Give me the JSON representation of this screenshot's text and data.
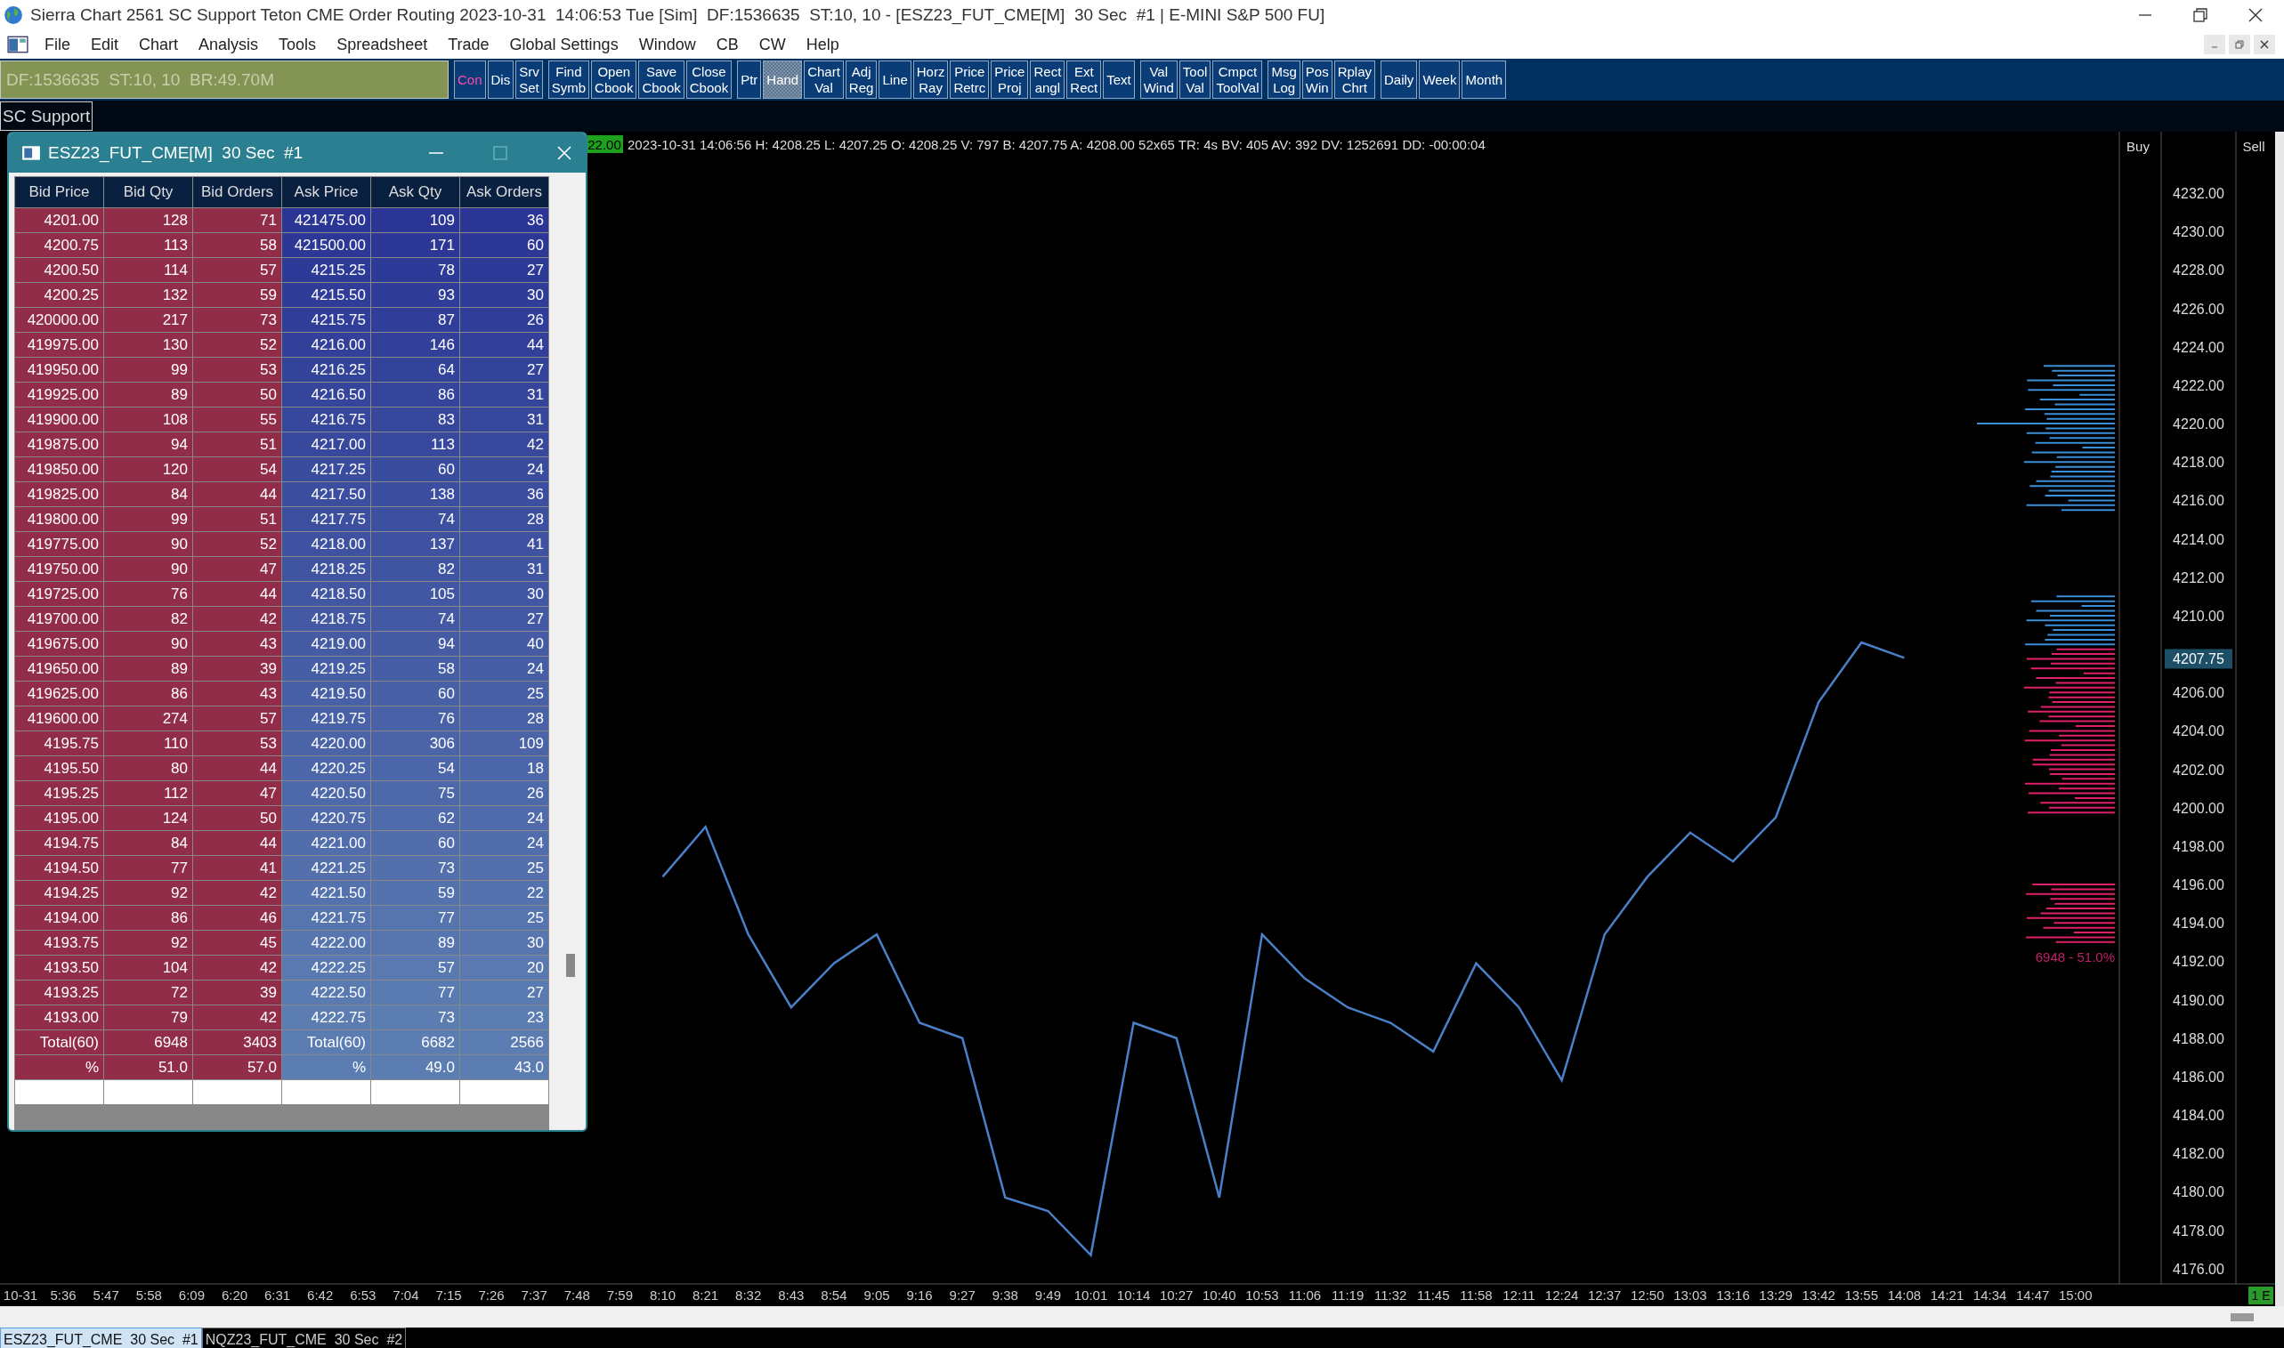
{
  "window": {
    "title": "Sierra Chart 2561 SC Support Teton CME Order Routing 2023-10-31  14:06:53 Tue [Sim]  DF:1536635  ST:10, 10 - [ESZ23_FUT_CME[M]  30 Sec  #1 | E-MINI S&P 500 FU]"
  },
  "menu": {
    "items": [
      "File",
      "Edit",
      "Chart",
      "Analysis",
      "Tools",
      "Spreadsheet",
      "Trade",
      "Global Settings",
      "Window",
      "CB",
      "CW",
      "Help"
    ]
  },
  "status": {
    "text": "DF:1536635  ST:10, 10  BR:49.70M"
  },
  "toolbar": {
    "groups": [
      {
        "buttons": [
          {
            "label": "Con",
            "lit": true,
            "selected": false
          },
          {
            "label": "Dis",
            "lit": false,
            "selected": false
          },
          {
            "label": "Srv\nSet",
            "lit": false,
            "selected": false
          }
        ]
      },
      {
        "buttons": [
          {
            "label": "Find\nSymb",
            "lit": false,
            "selected": false
          },
          {
            "label": "Open\nCbook",
            "lit": false,
            "selected": false
          },
          {
            "label": "Save\nCbook",
            "lit": false,
            "selected": false
          },
          {
            "label": "Close\nCbook",
            "lit": false,
            "selected": false
          }
        ]
      },
      {
        "buttons": [
          {
            "label": "Ptr",
            "lit": false,
            "selected": false
          },
          {
            "label": "Hand",
            "lit": false,
            "selected": true
          },
          {
            "label": "Chart\nVal",
            "lit": false,
            "selected": false
          },
          {
            "label": "Adj\nReg",
            "lit": false,
            "selected": false
          },
          {
            "label": "Line",
            "lit": false,
            "selected": false
          },
          {
            "label": "Horz\nRay",
            "lit": false,
            "selected": false
          },
          {
            "label": "Price\nRetrc",
            "lit": false,
            "selected": false
          },
          {
            "label": "Price\nProj",
            "lit": false,
            "selected": false
          },
          {
            "label": "Rect\nangl",
            "lit": false,
            "selected": false
          },
          {
            "label": "Ext\nRect",
            "lit": false,
            "selected": false
          },
          {
            "label": "Text",
            "lit": false,
            "selected": false
          }
        ]
      },
      {
        "buttons": [
          {
            "label": "Val\nWind",
            "lit": false,
            "selected": false
          },
          {
            "label": "Tool\nVal",
            "lit": false,
            "selected": false
          },
          {
            "label": "Cmpct\nToolVal",
            "lit": false,
            "selected": false
          }
        ]
      },
      {
        "buttons": [
          {
            "label": "Msg\nLog",
            "lit": false,
            "selected": false
          },
          {
            "label": "Pos\nWin",
            "lit": false,
            "selected": false
          },
          {
            "label": "Rplay\nChrt",
            "lit": false,
            "selected": false
          }
        ]
      },
      {
        "buttons": [
          {
            "label": "Daily",
            "lit": false,
            "selected": false
          },
          {
            "label": "Week",
            "lit": false,
            "selected": false
          },
          {
            "label": "Month",
            "lit": false,
            "selected": false
          }
        ]
      }
    ]
  },
  "chartbook_tabs": [
    {
      "label": "SC Support"
    }
  ],
  "dom_window": {
    "title": "ESZ23_FUT_CME[M]  30 Sec  #1",
    "columns": [
      "Bid Price",
      "Bid Qty",
      "Bid Orders",
      "Ask Price",
      "Ask Qty",
      "Ask Orders"
    ],
    "rows": [
      [
        "4201.00",
        "128",
        "71",
        "421475.00",
        "109",
        "36"
      ],
      [
        "4200.75",
        "113",
        "58",
        "421500.00",
        "171",
        "60"
      ],
      [
        "4200.50",
        "114",
        "57",
        "4215.25",
        "78",
        "27"
      ],
      [
        "4200.25",
        "132",
        "59",
        "4215.50",
        "93",
        "30"
      ],
      [
        "420000.00",
        "217",
        "73",
        "4215.75",
        "87",
        "26"
      ],
      [
        "419975.00",
        "130",
        "52",
        "4216.00",
        "146",
        "44"
      ],
      [
        "419950.00",
        "99",
        "53",
        "4216.25",
        "64",
        "27"
      ],
      [
        "419925.00",
        "89",
        "50",
        "4216.50",
        "86",
        "31"
      ],
      [
        "419900.00",
        "108",
        "55",
        "4216.75",
        "83",
        "31"
      ],
      [
        "419875.00",
        "94",
        "51",
        "4217.00",
        "113",
        "42"
      ],
      [
        "419850.00",
        "120",
        "54",
        "4217.25",
        "60",
        "24"
      ],
      [
        "419825.00",
        "84",
        "44",
        "4217.50",
        "138",
        "36"
      ],
      [
        "419800.00",
        "99",
        "51",
        "4217.75",
        "74",
        "28"
      ],
      [
        "419775.00",
        "90",
        "52",
        "4218.00",
        "137",
        "41"
      ],
      [
        "419750.00",
        "90",
        "47",
        "4218.25",
        "82",
        "31"
      ],
      [
        "419725.00",
        "76",
        "44",
        "4218.50",
        "105",
        "30"
      ],
      [
        "419700.00",
        "82",
        "42",
        "4218.75",
        "74",
        "27"
      ],
      [
        "419675.00",
        "90",
        "43",
        "4219.00",
        "94",
        "40"
      ],
      [
        "419650.00",
        "89",
        "39",
        "4219.25",
        "58",
        "24"
      ],
      [
        "419625.00",
        "86",
        "43",
        "4219.50",
        "60",
        "25"
      ],
      [
        "419600.00",
        "274",
        "57",
        "4219.75",
        "76",
        "28"
      ],
      [
        "4195.75",
        "110",
        "53",
        "4220.00",
        "306",
        "109"
      ],
      [
        "4195.50",
        "80",
        "44",
        "4220.25",
        "54",
        "18"
      ],
      [
        "4195.25",
        "112",
        "47",
        "4220.50",
        "75",
        "26"
      ],
      [
        "4195.00",
        "124",
        "50",
        "4220.75",
        "62",
        "24"
      ],
      [
        "4194.75",
        "84",
        "44",
        "4221.00",
        "60",
        "24"
      ],
      [
        "4194.50",
        "77",
        "41",
        "4221.25",
        "73",
        "25"
      ],
      [
        "4194.25",
        "92",
        "42",
        "4221.50",
        "59",
        "22"
      ],
      [
        "4194.00",
        "86",
        "46",
        "4221.75",
        "77",
        "25"
      ],
      [
        "4193.75",
        "92",
        "45",
        "4222.00",
        "89",
        "30"
      ],
      [
        "4193.50",
        "104",
        "42",
        "4222.25",
        "57",
        "20"
      ],
      [
        "4193.25",
        "72",
        "39",
        "4222.50",
        "77",
        "27"
      ],
      [
        "4193.00",
        "79",
        "42",
        "4222.75",
        "73",
        "23"
      ],
      [
        "Total(60)",
        "6948",
        "3403",
        "Total(60)",
        "6682",
        "2566"
      ],
      [
        "%",
        "51.0",
        "57.0",
        "%",
        "49.0",
        "43.0"
      ]
    ]
  },
  "chart": {
    "last_tag": "22.00",
    "info": "2023-10-31 14:06:56 H: 4208.25 L: 4207.25 O: 4208.25 V: 797 B: 4207.75 A: 4208.00 52x65 TR: 4s BV: 405 AV: 392 DV: 1252691 DD: -00:00:04",
    "buy_header": "Buy",
    "sell_header": "Sell",
    "current_price": "4207.75",
    "profile_label": "6948 - 51.0%",
    "end_tag": "1 E",
    "chart_data": {
      "type": "line",
      "x": [
        "10-31",
        "5:36",
        "5:47",
        "5:58",
        "6:09",
        "6:20",
        "6:31",
        "6:42",
        "6:53",
        "7:04",
        "7:15",
        "7:26",
        "7:37",
        "7:48",
        "7:59",
        "8:10",
        "8:21",
        "8:32",
        "8:43",
        "8:54",
        "9:05",
        "9:16",
        "9:27",
        "9:38",
        "9:49",
        "10:01",
        "10:14",
        "10:27",
        "10:40",
        "10:53",
        "11:06",
        "11:19",
        "11:32",
        "11:45",
        "11:58",
        "12:11",
        "12:24",
        "12:37",
        "12:50",
        "13:03",
        "13:16",
        "13:29",
        "13:42",
        "13:55",
        "14:08",
        "14:21",
        "14:34",
        "14:47",
        "15:00"
      ],
      "series": [
        {
          "color": "#4a80c8",
          "values": [
            null,
            null,
            null,
            null,
            null,
            null,
            null,
            null,
            null,
            null,
            null,
            null,
            null,
            null,
            null,
            4196.4,
            4199.0,
            4193.4,
            4189.6,
            4191.9,
            4193.4,
            4188.8,
            4188.0,
            4179.7,
            4179.0,
            4176.7,
            4188.8,
            4188.0,
            4179.7,
            4193.4,
            4191.1,
            4189.6,
            4188.8,
            4187.3,
            4191.9,
            4189.6,
            4185.8,
            4193.4,
            4196.4,
            4198.7,
            4197.2,
            4199.5,
            4205.5,
            4208.6,
            4207.8,
            null,
            null,
            null,
            null
          ]
        }
      ],
      "ylim": [
        4175.2,
        4235.2
      ],
      "yticks": [
        {
          "value": 4176,
          "label": "4176.00"
        },
        {
          "value": 4178,
          "label": "4178.00"
        },
        {
          "value": 4180,
          "label": "4180.00"
        },
        {
          "value": 4182,
          "label": "4182.00"
        },
        {
          "value": 4184,
          "label": "4184.00"
        },
        {
          "value": 4186,
          "label": "4186.00"
        },
        {
          "value": 4188,
          "label": "4188.00"
        },
        {
          "value": 4190,
          "label": "4190.00"
        },
        {
          "value": 4192,
          "label": "4192.00"
        },
        {
          "value": 4194,
          "label": "4194.00"
        },
        {
          "value": 4196,
          "label": "4196.00"
        },
        {
          "value": 4198,
          "label": "4198.00"
        },
        {
          "value": 4200,
          "label": "4200.00"
        },
        {
          "value": 4202,
          "label": "4202.00"
        },
        {
          "value": 4204,
          "label": "4204.00"
        },
        {
          "value": 4206,
          "label": "4206.00"
        },
        {
          "value": 4210,
          "label": "4210.00"
        },
        {
          "value": 4212,
          "label": "4212.00"
        },
        {
          "value": 4214,
          "label": "4214.00"
        },
        {
          "value": 4216,
          "label": "4216.00"
        },
        {
          "value": 4218,
          "label": "4218.00"
        },
        {
          "value": 4220,
          "label": "4220.00"
        },
        {
          "value": 4222,
          "label": "4222.00"
        },
        {
          "value": 4224,
          "label": "4224.00"
        },
        {
          "value": 4226,
          "label": "4226.00"
        },
        {
          "value": 4228,
          "label": "4228.00"
        },
        {
          "value": 4230,
          "label": "4230.00"
        },
        {
          "value": 4232,
          "label": "4232.00"
        }
      ]
    }
  },
  "bottom_tabs": [
    {
      "label": "ESZ23_FUT_CME  30 Sec  #1",
      "selected": true
    },
    {
      "label": "NQZ23_FUT_CME  30 Sec  #2",
      "selected": false
    }
  ]
}
